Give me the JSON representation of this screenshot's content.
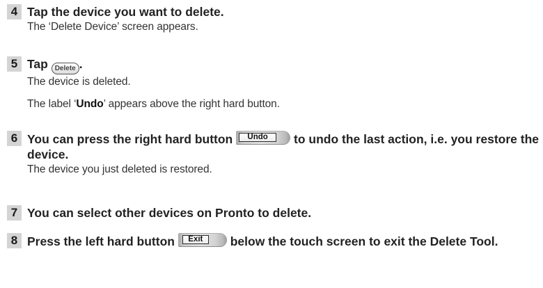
{
  "steps": [
    {
      "number": "4",
      "instruction": "Tap the device you want to delete.",
      "result": "The ‘Delete Device’ screen appears."
    },
    {
      "number": "5",
      "instruction_prefix": "Tap",
      "button_label": "Delete",
      "instruction_suffix": ".",
      "result_1": "The device is deleted.",
      "result_2_prefix": "The label ‘",
      "result_2_bold": "Undo",
      "result_2_suffix": "’ appears above the right hard button."
    },
    {
      "number": "6",
      "instruction_prefix": "You can press the right hard button",
      "button_label": "Undo",
      "instruction_suffix": "to undo the last action, i.e. you restore the device.",
      "result": "The device you just deleted is restored."
    },
    {
      "number": "7",
      "instruction": "You can select other devices on Pronto to delete."
    },
    {
      "number": "8",
      "instruction_prefix": "Press the left hard button",
      "button_label": "Exit",
      "instruction_suffix": "below the touch screen to exit the Delete Tool."
    }
  ]
}
